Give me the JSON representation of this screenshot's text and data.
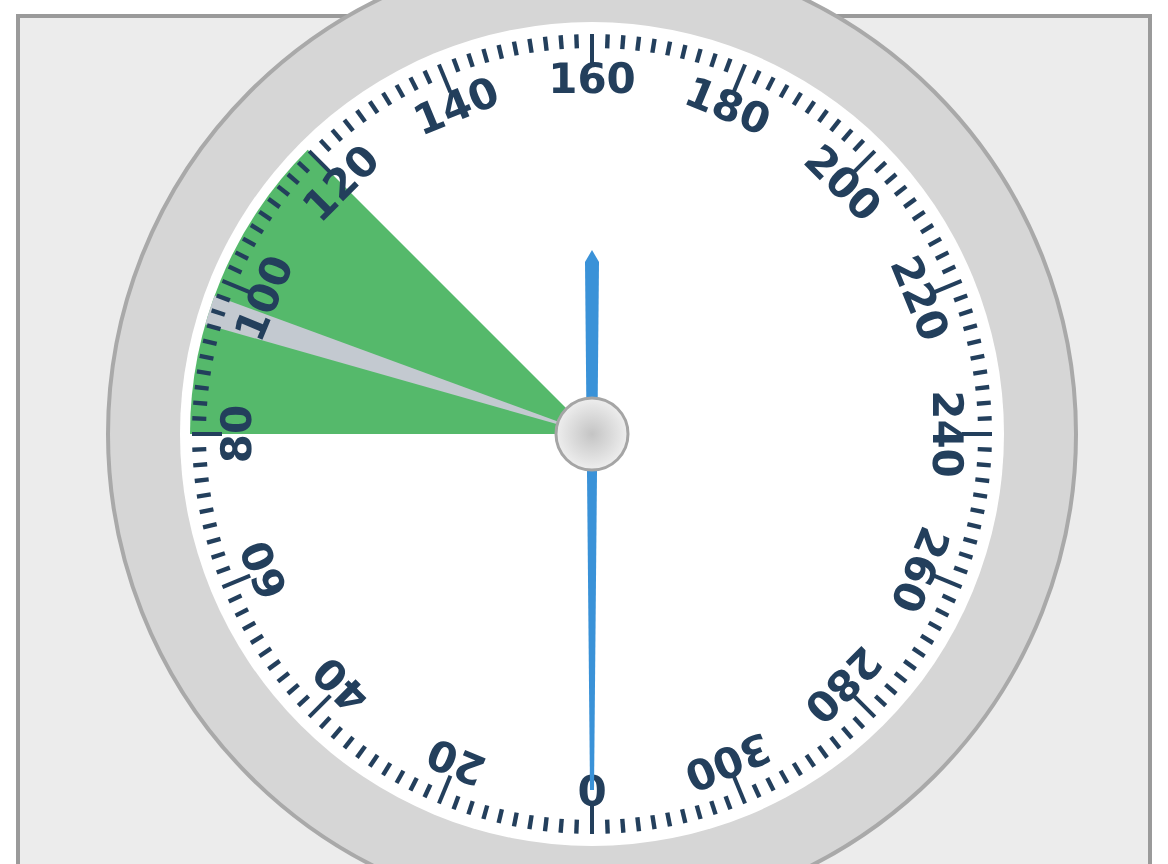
{
  "gauge": {
    "scale_labels": [
      "0",
      "20",
      "40",
      "60",
      "80",
      "100",
      "120",
      "140",
      "160",
      "180",
      "200",
      "220",
      "240",
      "260",
      "280",
      "300"
    ],
    "zone": {
      "color": "#55b96b",
      "start": {
        "level": 0.25
      },
      "end": {
        "level": 0.375
      }
    },
    "marker": {
      "start": {
        "level": 0.294
      },
      "end": {
        "level": 0.306
      }
    },
    "needle": {
      "level": 0
    }
  }
}
